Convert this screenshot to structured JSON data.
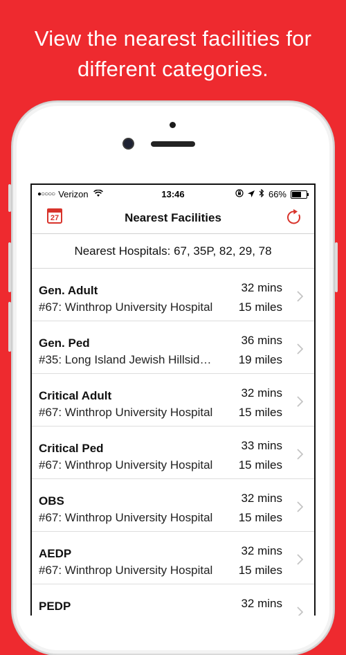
{
  "promo": {
    "line1": "View the nearest facilities for",
    "line2": "different categories."
  },
  "status_bar": {
    "signal": "●○○○○",
    "carrier": "Verizon",
    "time": "13:46",
    "battery_text": "66%",
    "battery_level": 0.66
  },
  "nav": {
    "title": "Nearest Facilities",
    "calendar_day": "27"
  },
  "summary": "Nearest Hospitals: 67, 35P, 82, 29, 78",
  "rows": [
    {
      "category": "Gen. Adult",
      "facility": "#67: Winthrop University Hospital",
      "mins": "32 mins",
      "miles": "15 miles"
    },
    {
      "category": "Gen. Ped",
      "facility": "#35: Long Island Jewish Hillsid…",
      "mins": "36 mins",
      "miles": "19 miles"
    },
    {
      "category": "Critical Adult",
      "facility": "#67: Winthrop University Hospital",
      "mins": "32 mins",
      "miles": "15 miles"
    },
    {
      "category": "Critical Ped",
      "facility": "#67: Winthrop University Hospital",
      "mins": "33 mins",
      "miles": "15 miles"
    },
    {
      "category": "OBS",
      "facility": "#67: Winthrop University Hospital",
      "mins": "32 mins",
      "miles": "15 miles"
    },
    {
      "category": "AEDP",
      "facility": "#67: Winthrop University Hospital",
      "mins": "32 mins",
      "miles": "15 miles"
    },
    {
      "category": "PEDP",
      "facility": "",
      "mins": "32 mins",
      "miles": ""
    }
  ],
  "colors": {
    "background": "#ee2a2f",
    "accent": "#d8332b"
  }
}
